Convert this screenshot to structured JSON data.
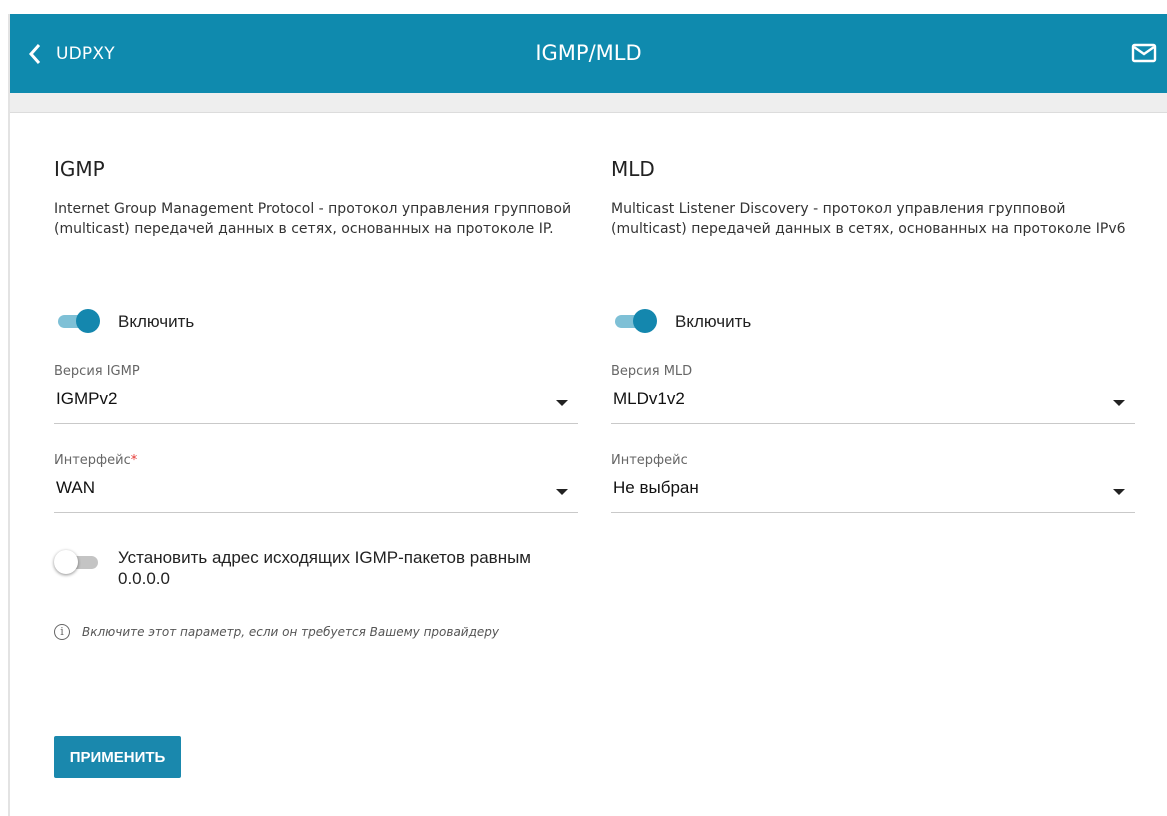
{
  "header": {
    "back_label": "UDPXY",
    "title": "IGMP/MLD",
    "background": "#0f8aae"
  },
  "igmp": {
    "title": "IGMP",
    "description": "Internet Group Management Protocol - протокол управления групповой (multicast) передачей данных в сетях, основанных на протоколе IP.",
    "enable_label": "Включить",
    "enabled": true,
    "version_label": "Версия IGMP",
    "version_value": "IGMPv2",
    "interface_label": "Интерфейс",
    "interface_required": "*",
    "interface_value": "WAN",
    "zero_addr_label": "Установить адрес исходящих IGMP-пакетов равным 0.0.0.0",
    "zero_addr_enabled": false,
    "hint": "Включите этот параметр, если он требуется Вашему провайдеру"
  },
  "mld": {
    "title": "MLD",
    "description": "Multicast Listener Discovery - протокол управления групповой (multicast) передачей данных в сетях, основанных на протоколе IPv6",
    "enable_label": "Включить",
    "enabled": true,
    "version_label": "Версия MLD",
    "version_value": "MLDv1v2",
    "interface_label": "Интерфейс",
    "interface_value": "Не выбран"
  },
  "apply_label": "ПРИМЕНИТЬ",
  "colors": {
    "accent": "#1487ae",
    "required": "#e53935"
  },
  "icons": [
    "chevron-left-icon",
    "mail-icon",
    "caret-down-icon",
    "info-icon"
  ]
}
